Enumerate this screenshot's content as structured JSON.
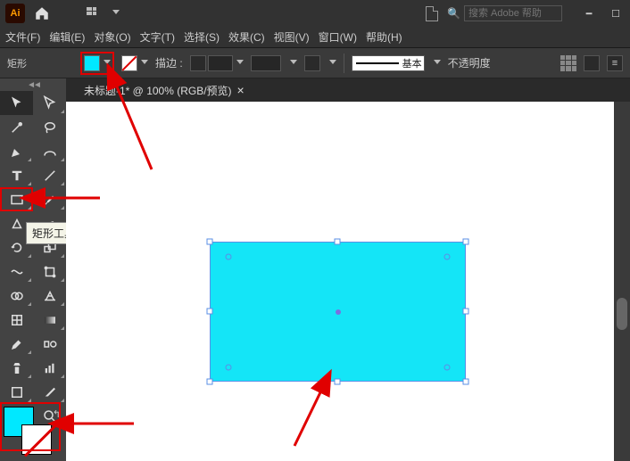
{
  "titlebar": {
    "app": "Ai",
    "search_placeholder": "搜索 Adobe 帮助",
    "search_icon": "Q"
  },
  "menu": [
    "文件(F)",
    "编辑(E)",
    "对象(O)",
    "文字(T)",
    "选择(S)",
    "效果(C)",
    "视图(V)",
    "窗口(W)",
    "帮助(H)"
  ],
  "ctrl": {
    "shape": "矩形",
    "stroke_label": "描边 :",
    "stroke_style_label": "基本",
    "opacity_label": "不透明度"
  },
  "tab": {
    "title": "未标题-1* @ 100% (RGB/预览)"
  },
  "tooltip": {
    "rectangle": "矩形工具 (M)"
  },
  "colors": {
    "fill": "#00e8ff",
    "accent_red": "#e00000"
  }
}
